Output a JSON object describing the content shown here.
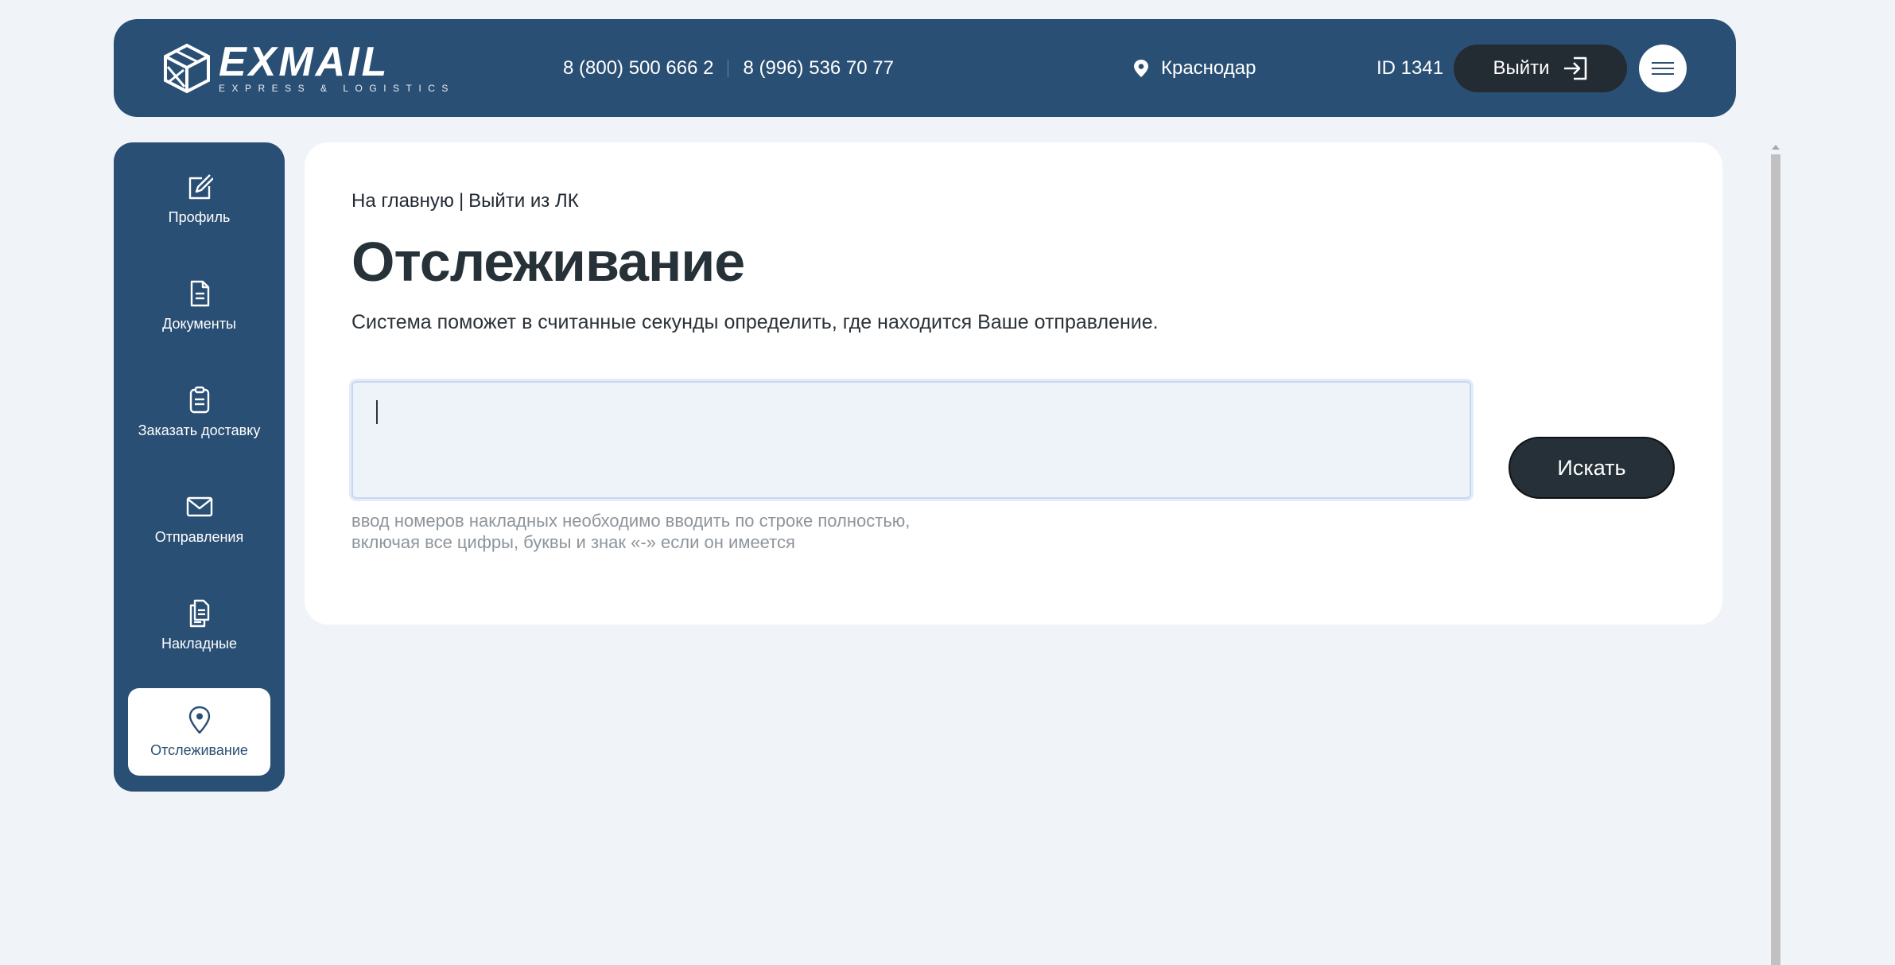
{
  "header": {
    "logo_word": "EXMAIL",
    "logo_tagline": "EXPRESS & LOGISTICS",
    "phones": [
      "8 (800) 500 666 2",
      "8 (996) 536 70 77"
    ],
    "city": "Краснодар",
    "user_id": "ID 1341",
    "logout_label": "Выйти"
  },
  "sidebar": {
    "items": [
      {
        "label": "Профиль",
        "icon": "edit-profile-icon"
      },
      {
        "label": "Документы",
        "icon": "document-icon"
      },
      {
        "label": "Заказать доставку",
        "icon": "clipboard-icon"
      },
      {
        "label": "Отправления",
        "icon": "envelope-icon"
      },
      {
        "label": "Накладные",
        "icon": "files-icon"
      },
      {
        "label": "Отслеживание",
        "icon": "location-pin-icon",
        "active": true
      }
    ]
  },
  "main": {
    "breadcrumb": {
      "home": "На главную",
      "separator": "|",
      "logout": "Выйти из ЛК"
    },
    "title": "Отслеживание",
    "subtitle": "Система поможет в считанные секунды определить, где находится Ваше отправление.",
    "input": {
      "value": "",
      "placeholder": ""
    },
    "hint_line1": "ввод номеров накладных необходимо вводить по строке полностью,",
    "hint_line2": "включая все цифры, буквы и знак «-» если он имеется",
    "search_label": "Искать"
  },
  "colors": {
    "brand": "#2a4f74",
    "dark_button": "#263038",
    "background": "#f0f4f9"
  }
}
